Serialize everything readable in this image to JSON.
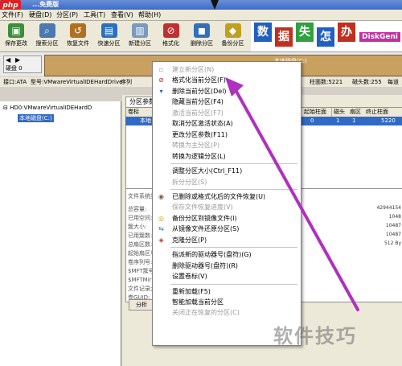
{
  "window": {
    "title": "...免费版"
  },
  "menu": [
    "文件(F)",
    "硬盘(D)",
    "分区(P)",
    "工具(T)",
    "查看(V)",
    "帮助(H)"
  ],
  "toolbar": [
    {
      "label": "保存更改",
      "icon": "save-icon",
      "color": "#3a8f3a"
    },
    {
      "label": "搜索分区",
      "icon": "search-icon",
      "color": "#4a7ab0"
    },
    {
      "label": "恢复文件",
      "icon": "restore-icon",
      "color": "#b07020"
    },
    {
      "label": "快速分区",
      "icon": "quick-partition-icon",
      "color": "#2a70c0"
    },
    {
      "label": "新建分区",
      "icon": "new-partition-icon",
      "color": "#7a9ac0"
    },
    {
      "label": "格式化",
      "icon": "format-icon",
      "color": "#c03030"
    },
    {
      "label": "删除分区",
      "icon": "delete-icon",
      "color": "#3070c0"
    },
    {
      "label": "备份分区",
      "icon": "backup-icon",
      "color": "#c0a020"
    }
  ],
  "ad": {
    "chars": [
      "数",
      "据",
      "失",
      "怎",
      "办"
    ],
    "brand": "DiskGeni"
  },
  "disk": {
    "label": "硬盘 0",
    "partition_label": "本地磁盘(C:)"
  },
  "infobar": {
    "iface": "接口:ATA",
    "model": "型号:VMwareVirtualIDEHardDrive",
    "more": "序列",
    "cyl": "柱面数:5221",
    "heads": "磁头数:255",
    "sectors": "每道"
  },
  "tree": {
    "disk": "HD0:VMwareVirtualIDEHardD",
    "partition": "本地磁盘(C:)"
  },
  "panel": {
    "tab": "分区参数",
    "columns": [
      "卷标",
      "起始柱面",
      "磁头",
      "扇区",
      "终止柱面"
    ],
    "row": [
      "本地",
      "0",
      "1",
      "1",
      "5220"
    ],
    "fs_label": "文件系统类",
    "props": [
      "总容量:",
      "已用空间:",
      "簇大小:",
      "已用簇数:",
      "总扇区数:",
      "起始扇区号:",
      "卷序列号:",
      "$MFT簇号:",
      "$MFTMirr簇号:",
      "文件记录大小:",
      "卷GUID:"
    ],
    "values": [
      "42944154",
      "1048",
      "10487",
      "10487",
      "512 By"
    ],
    "bottom_tab": "分析"
  },
  "context_menu": [
    {
      "label": "建立新分区(N)",
      "disabled": true,
      "icon": "new-icon"
    },
    {
      "label": "格式化当前分区(F)",
      "disabled": false,
      "icon": "format-icon"
    },
    {
      "label": "删除当前分区(Del)",
      "disabled": false,
      "icon": "delete-icon"
    },
    {
      "label": "隐藏当前分区(F4)",
      "disabled": false,
      "icon": ""
    },
    {
      "label": "激活当前分区(F7)",
      "disabled": true,
      "icon": ""
    },
    {
      "label": "取消分区激活状态(A)",
      "disabled": false,
      "icon": ""
    },
    {
      "label": "更改分区参数(F11)",
      "disabled": false,
      "icon": ""
    },
    {
      "label": "转换为主分区(P)",
      "disabled": true,
      "icon": ""
    },
    {
      "label": "转换为逻辑分区(L)",
      "disabled": false,
      "icon": ""
    },
    {
      "sep": true
    },
    {
      "label": "调整分区大小(Ctrl_F11)",
      "disabled": false,
      "icon": ""
    },
    {
      "label": "拆分分区(S)",
      "disabled": true,
      "icon": ""
    },
    {
      "sep": true
    },
    {
      "label": "已删除或格式化后的文件恢复(U)",
      "disabled": false,
      "icon": "recover-icon"
    },
    {
      "label": "保存文件恢复进度(V)",
      "disabled": true,
      "icon": ""
    },
    {
      "label": "备份分区到镜像文件(I)",
      "disabled": false,
      "icon": "backup-icon"
    },
    {
      "label": "从镜像文件还原分区(S)",
      "disabled": false,
      "icon": "restore-icon"
    },
    {
      "label": "克隆分区(P)",
      "disabled": false,
      "icon": "clone-icon"
    },
    {
      "sep": true
    },
    {
      "label": "指派新的驱动器号(盘符)(G)",
      "disabled": false,
      "icon": ""
    },
    {
      "label": "删除驱动器号(盘符)(R)",
      "disabled": false,
      "icon": ""
    },
    {
      "label": "设置卷标(V)",
      "disabled": false,
      "icon": ""
    },
    {
      "sep": true
    },
    {
      "label": "重新加载(F5)",
      "disabled": false,
      "icon": ""
    },
    {
      "label": "智能加载当前分区",
      "disabled": false,
      "icon": ""
    },
    {
      "label": "关闭正在恢复的分区(C)",
      "disabled": true,
      "icon": ""
    }
  ],
  "watermark": "软件技巧",
  "logo": "php",
  "colors": {
    "arrow": "#b030c0",
    "selection": "#316ac5"
  }
}
